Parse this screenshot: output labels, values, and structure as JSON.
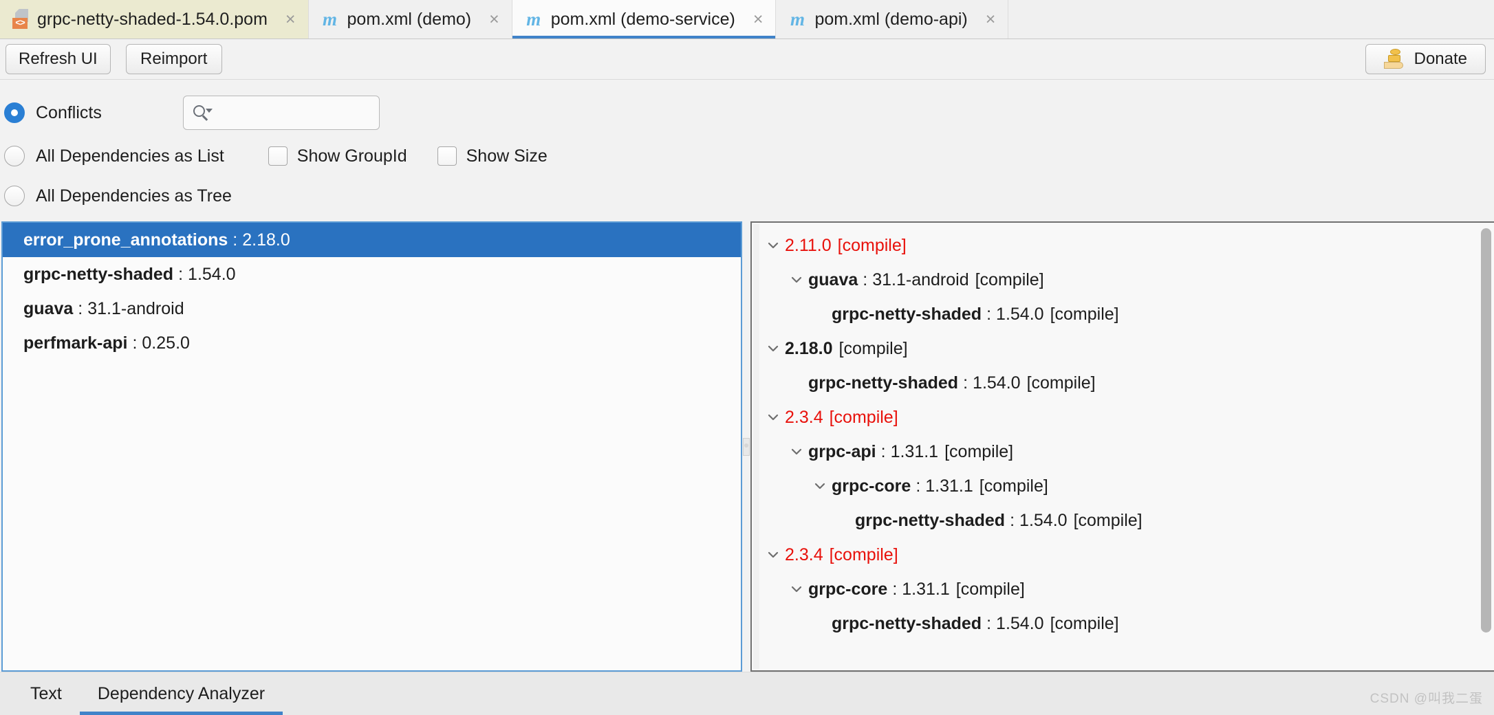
{
  "editor_tabs": [
    {
      "label": "grpc-netty-shaded-1.54.0.pom",
      "icon": "xml-file-icon",
      "close": "×",
      "active": false,
      "kind": "pom-file"
    },
    {
      "label": "pom.xml (demo)",
      "icon": "maven-icon",
      "close": "×",
      "active": false,
      "kind": "maven"
    },
    {
      "label": "pom.xml (demo-service)",
      "icon": "maven-icon",
      "close": "×",
      "active": true,
      "kind": "maven"
    },
    {
      "label": "pom.xml (demo-api)",
      "icon": "maven-icon",
      "close": "×",
      "active": false,
      "kind": "maven"
    }
  ],
  "toolbar": {
    "refresh_label": "Refresh UI",
    "reimport_label": "Reimport",
    "donate_label": "Donate"
  },
  "options": {
    "conflicts_label": "Conflicts",
    "all_as_list_label": "All Dependencies as List",
    "all_as_tree_label": "All Dependencies as Tree",
    "show_groupid_label": "Show GroupId",
    "show_size_label": "Show Size",
    "selected_radio": "Conflicts",
    "show_groupid_checked": false,
    "show_size_checked": false,
    "search_value": "",
    "search_placeholder": ""
  },
  "dependency_list": [
    {
      "artifact": "error_prone_annotations",
      "sep": ":",
      "version": "2.18.0",
      "selected": true
    },
    {
      "artifact": "grpc-netty-shaded",
      "sep": ":",
      "version": "1.54.0",
      "selected": false
    },
    {
      "artifact": "guava",
      "sep": ":",
      "version": "31.1-android",
      "selected": false
    },
    {
      "artifact": "perfmark-api",
      "sep": ":",
      "version": "0.25.0",
      "selected": false
    }
  ],
  "dependency_tree": [
    {
      "indent": 0,
      "expandable": true,
      "conflict": true,
      "version": "2.11.0",
      "scope": "[compile]"
    },
    {
      "indent": 1,
      "expandable": true,
      "conflict": false,
      "artifact": "guava",
      "sep": ":",
      "version": "31.1-android",
      "scope": "[compile]"
    },
    {
      "indent": 2,
      "expandable": false,
      "conflict": false,
      "artifact": "grpc-netty-shaded",
      "sep": ":",
      "version": "1.54.0",
      "scope": "[compile]"
    },
    {
      "indent": 0,
      "expandable": true,
      "conflict": false,
      "version": "2.18.0",
      "scope": "[compile]"
    },
    {
      "indent": 1,
      "expandable": false,
      "conflict": false,
      "artifact": "grpc-netty-shaded",
      "sep": ":",
      "version": "1.54.0",
      "scope": "[compile]"
    },
    {
      "indent": 0,
      "expandable": true,
      "conflict": true,
      "version": "2.3.4",
      "scope": "[compile]"
    },
    {
      "indent": 1,
      "expandable": true,
      "conflict": false,
      "artifact": "grpc-api",
      "sep": ":",
      "version": "1.31.1",
      "scope": "[compile]"
    },
    {
      "indent": 2,
      "expandable": true,
      "conflict": false,
      "artifact": "grpc-core",
      "sep": ":",
      "version": "1.31.1",
      "scope": "[compile]"
    },
    {
      "indent": 3,
      "expandable": false,
      "conflict": false,
      "artifact": "grpc-netty-shaded",
      "sep": ":",
      "version": "1.54.0",
      "scope": "[compile]"
    },
    {
      "indent": 0,
      "expandable": true,
      "conflict": true,
      "version": "2.3.4",
      "scope": "[compile]"
    },
    {
      "indent": 1,
      "expandable": true,
      "conflict": false,
      "artifact": "grpc-core",
      "sep": ":",
      "version": "1.31.1",
      "scope": "[compile]"
    },
    {
      "indent": 2,
      "expandable": false,
      "conflict": false,
      "artifact": "grpc-netty-shaded",
      "sep": ":",
      "version": "1.54.0",
      "scope": "[compile]"
    }
  ],
  "bottom_tabs": [
    {
      "label": "Text",
      "active": false
    },
    {
      "label": "Dependency Analyzer",
      "active": true
    }
  ],
  "watermark": "CSDN @叫我二蛋",
  "colors": {
    "accent": "#4083c9",
    "selection": "#2a72c0",
    "conflict": "#e8110b",
    "pom_tab_bg": "#ebead0",
    "maven_icon": "#62b5e5"
  }
}
